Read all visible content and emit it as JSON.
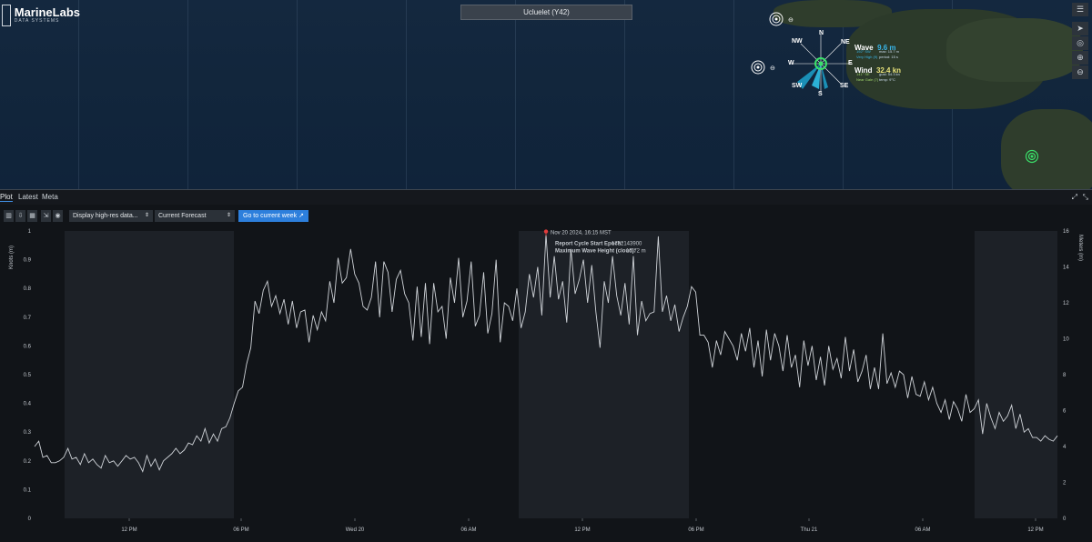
{
  "app": {
    "logo_name": "MarineLabs",
    "logo_sub": "DATA SYSTEMS",
    "station": "Ucluelet (Y42)"
  },
  "map": {
    "compass": {
      "n": "N",
      "ne": "NE",
      "e": "E",
      "se": "SE",
      "s": "S",
      "sw": "SW",
      "w": "W",
      "nw": "NW"
    },
    "wave": {
      "label": "Wave",
      "value": "9.6 m",
      "line1a": "192° SW",
      "line1b": "max: 15.7 m",
      "line2a": "Very High (9)",
      "line2b": "period: 15 s"
    },
    "wind": {
      "label": "Wind",
      "value": "32.4 kn",
      "line1a": "141° SE",
      "line1b": "gust: 54.3 kn",
      "line2a": "Near Gale (7)",
      "line2b": "temp: 9°C"
    },
    "toolbar_icons": [
      "menu-icon",
      "navigate-icon",
      "target-icon",
      "zoom-in-icon",
      "zoom-out-icon"
    ]
  },
  "tabs": [
    "Plot",
    "Latest",
    "Meta"
  ],
  "toolbar": {
    "display_select": "Display high-res data...",
    "forecast_select": "Current Forecast",
    "go_button": "Go to current week"
  },
  "tooltip": {
    "time": "Nov 20 2024, 16:15 MST",
    "line1_label": "Report Cycle Start Epoch:",
    "line1_value": "1732143900",
    "line2_label": "Maximum Wave Height (cloud):",
    "line2_value": "15.72 m"
  },
  "chart_data": {
    "type": "line",
    "ylabel_left": "Knots (m)",
    "ylabel_right": "Meters (m)",
    "y_left_ticks": [
      "0",
      "0.1",
      "0.2",
      "0.3",
      "0.4",
      "0.5",
      "0.6",
      "0.7",
      "0.8",
      "0.9",
      "1"
    ],
    "y_right_ticks": [
      "0",
      "2",
      "4",
      "6",
      "8",
      "10",
      "12",
      "14",
      "16"
    ],
    "x_ticks": [
      "12 PM",
      "06 PM",
      "Wed 20",
      "06 AM",
      "12 PM",
      "06 PM",
      "Thu 21",
      "06 AM",
      "12 PM"
    ],
    "ylim_right": [
      0,
      16
    ],
    "series": [
      {
        "color": "#cfd3d8",
        "values": [
          4.0,
          4.3,
          3.4,
          3.5,
          3.1,
          3.1,
          3.2,
          3.4,
          3.9,
          3.3,
          3.4,
          3.0,
          3.6,
          3.1,
          3.3,
          3.0,
          2.8,
          3.5,
          3.1,
          3.2,
          2.9,
          3.2,
          3.5,
          3.3,
          3.4,
          3.1,
          2.6,
          3.5,
          2.9,
          3.3,
          2.7,
          3.2,
          3.4,
          3.6,
          3.9,
          3.6,
          3.8,
          4.2,
          4.1,
          4.6,
          4.3,
          5.0,
          4.2,
          4.7,
          4.3,
          5.0,
          5.1,
          5.6,
          6.4,
          7.1,
          7.3,
          8.6,
          9.5,
          12.1,
          11.4,
          12.7,
          13.2,
          11.8,
          12.4,
          11.4,
          12.2,
          10.8,
          12.1,
          10.6,
          11.5,
          11.6,
          9.8,
          11.3,
          10.5,
          11.5,
          11.0,
          13.2,
          12.0,
          14.5,
          13.1,
          13.4,
          15.0,
          13.6,
          13.1,
          11.8,
          11.6,
          12.3,
          14.3,
          11.2,
          14.3,
          13.7,
          11.5,
          13.3,
          13.8,
          12.5,
          12.0,
          9.9,
          12.9,
          10.1,
          13.1,
          9.7,
          13.1,
          11.5,
          11.8,
          10.0,
          13.4,
          12.0,
          14.5,
          11.2,
          12.1,
          14.3,
          10.7,
          11.3,
          13.7,
          10.3,
          11.4,
          14.4,
          9.8,
          12.0,
          11.8,
          11.0,
          12.8,
          10.6,
          11.5,
          13.6,
          12.3,
          14.0,
          11.3,
          15.8,
          12.3,
          14.6,
          12.2,
          13.2,
          10.9,
          15.0,
          12.5,
          13.3,
          14.4,
          12.0,
          14.1,
          11.5,
          9.5,
          13.2,
          12.0,
          14.6,
          12.4,
          11.3,
          13.1,
          10.8,
          14.6,
          10.2,
          12.1,
          11.0,
          11.4,
          11.5,
          15.7,
          11.5,
          12.4,
          11.0,
          11.9,
          10.4,
          11.2,
          11.8,
          12.9,
          12.6,
          10.2,
          10.2,
          9.8,
          8.4,
          9.9,
          9.1,
          10.4,
          10.0,
          9.6,
          8.8,
          10.3,
          9.3,
          10.6,
          8.4,
          9.9,
          7.9,
          10.5,
          8.8,
          10.3,
          9.6,
          8.2,
          10.2,
          8.4,
          9.1,
          7.3,
          9.9,
          8.5,
          9.6,
          7.7,
          9.0,
          7.4,
          9.6,
          8.3,
          8.9,
          7.8,
          10.1,
          8.2,
          9.4,
          7.6,
          8.2,
          9.1,
          7.2,
          8.4,
          7.2,
          10.3,
          7.5,
          8.1,
          7.3,
          8.2,
          8.0,
          6.7,
          7.9,
          6.9,
          6.8,
          7.6,
          6.6,
          7.3,
          6.4,
          5.9,
          6.6,
          5.5,
          6.5,
          6.1,
          5.4,
          6.9,
          5.9,
          6.1,
          6.6,
          4.7,
          6.4,
          5.6,
          5.0,
          5.9,
          5.4,
          5.7,
          6.3,
          5.0,
          5.8,
          4.8,
          5.0,
          4.5,
          4.5,
          4.3,
          4.6,
          4.4,
          4.3,
          4.6
        ]
      }
    ],
    "shaded_regions": [
      "night",
      "night",
      "night"
    ],
    "highlight_point": {
      "value": 15.72,
      "color": "#e23b3b"
    }
  }
}
